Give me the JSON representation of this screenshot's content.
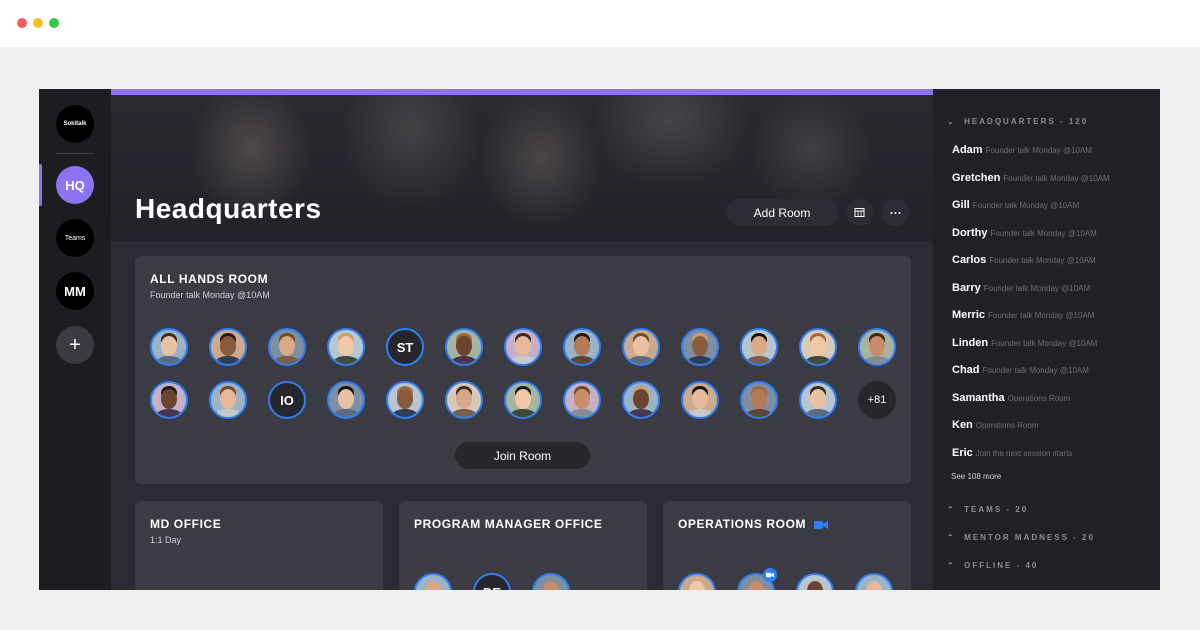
{
  "window": {
    "buttons": [
      "close",
      "minimize",
      "maximize"
    ]
  },
  "rail": {
    "logo": "Sokitalk",
    "items": [
      {
        "label": "HQ",
        "active": true
      },
      {
        "label": "Teams"
      },
      {
        "label": "MM"
      }
    ],
    "add_label": "+"
  },
  "header": {
    "title": "Headquarters",
    "add_room_label": "Add Room",
    "grid_icon": "calendar-icon",
    "more_icon": "more-icon"
  },
  "all_hands": {
    "title": "ALL HANDS ROOM",
    "subtitle": "Founder talk Monday @10AM",
    "initials": [
      "ST",
      "IO"
    ],
    "more_count": "+81",
    "join_label": "Join Room"
  },
  "rooms": [
    {
      "title": "MD OFFICE",
      "subtitle": "1:1 Day"
    },
    {
      "title": "PROGRAM MANAGER OFFICE",
      "subtitle": "",
      "initials": "DE"
    },
    {
      "title": "OPERATIONS ROOM",
      "subtitle": "",
      "has_camera": true
    }
  ],
  "sidebar": {
    "sections": {
      "headquarters": "HEADQUARTERS - 120",
      "teams": "TEAMS - 20",
      "mentor": "MENTOR MADNESS - 20",
      "offline": "OFFLINE - 40"
    },
    "members": [
      {
        "name": "Adam",
        "status": "Founder talk Monday @10AM",
        "indicator": "dot"
      },
      {
        "name": "Gretchen",
        "status": "Founder talk Monday @10AM",
        "indicator": "dot"
      },
      {
        "name": "Gill",
        "status": "Founder talk Monday @10AM",
        "indicator": "dot"
      },
      {
        "name": "Dorthy",
        "status": "Founder talk Monday @10AM",
        "indicator": "dot"
      },
      {
        "name": "Carlos",
        "status": "Founder talk Monday @10AM",
        "indicator": "dot"
      },
      {
        "name": "Barry",
        "status": "Founder talk Monday @10AM",
        "indicator": "dot"
      },
      {
        "name": "Merric",
        "status": "Founder talk Monday @10AM",
        "indicator": "dot"
      },
      {
        "name": "Linden",
        "status": "Founder talk Monday @10AM",
        "indicator": "dot"
      },
      {
        "name": "Chad",
        "status": "Founder talk Monday @10AM",
        "indicator": "dot"
      },
      {
        "name": "Samantha",
        "status": "Operations Room",
        "indicator": "camera"
      },
      {
        "name": "Ken",
        "status": "Operations Room",
        "indicator": "camera"
      },
      {
        "name": "Eric",
        "status": "Join the next session starts",
        "indicator": "dot"
      }
    ],
    "see_more": "See 108 more"
  },
  "colors": {
    "accent": "#8c74f0",
    "online": "#2f7ff5",
    "background": "#2b2c33",
    "card": "#3a3b43",
    "sidebar": "#202126"
  }
}
